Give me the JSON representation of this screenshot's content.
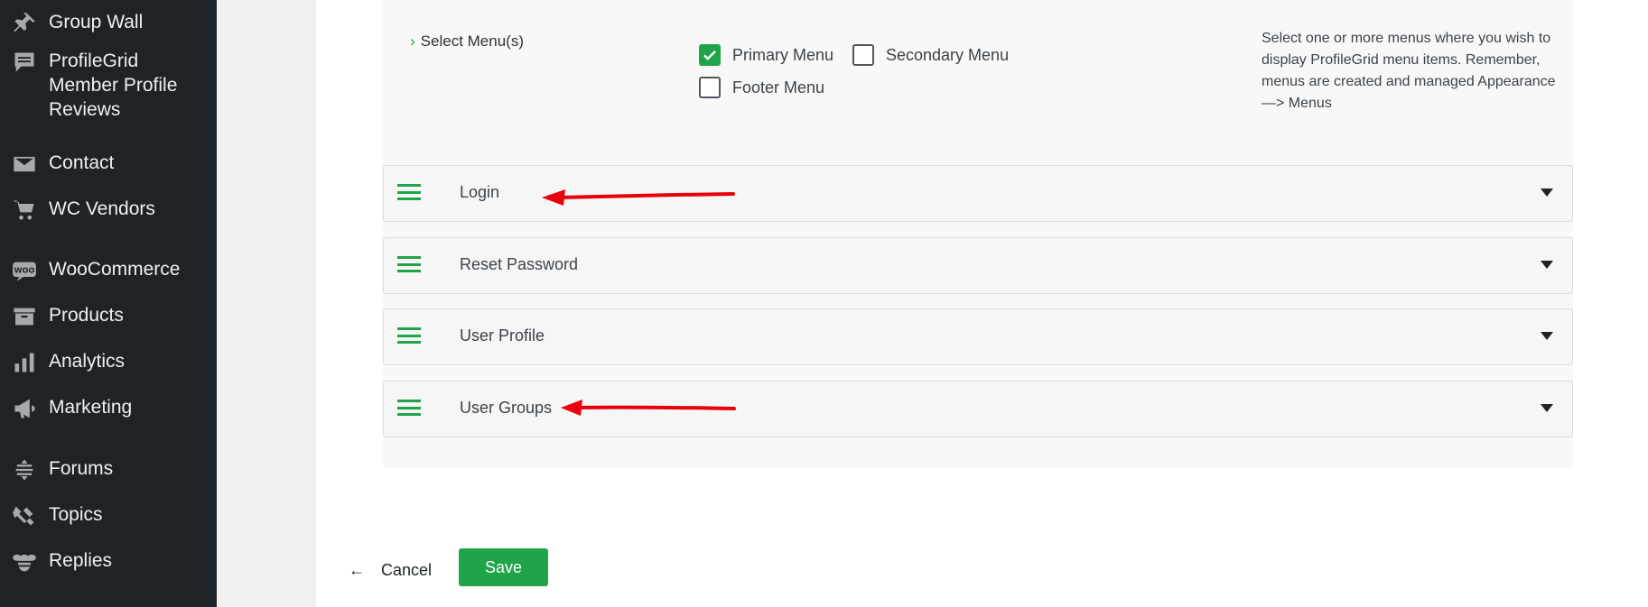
{
  "sidebar": {
    "items": [
      {
        "label": "Group Wall",
        "icon": "pin-icon"
      },
      {
        "label": "ProfileGrid Member Profile Reviews",
        "icon": "comment-icon"
      },
      {
        "label": "Contact",
        "icon": "mail-icon"
      },
      {
        "label": "WC Vendors",
        "icon": "cart-icon"
      },
      {
        "label": "WooCommerce",
        "icon": "woo-icon"
      },
      {
        "label": "Products",
        "icon": "archive-icon"
      },
      {
        "label": "Analytics",
        "icon": "bar-chart-icon"
      },
      {
        "label": "Marketing",
        "icon": "megaphone-icon"
      },
      {
        "label": "Forums",
        "icon": "forums-icon"
      },
      {
        "label": "Topics",
        "icon": "topics-icon"
      },
      {
        "label": "Replies",
        "icon": "bee-icon"
      }
    ]
  },
  "menu_settings": {
    "label": "Select Menu(s)",
    "options": [
      {
        "label": "Primary Menu",
        "checked": true
      },
      {
        "label": "Secondary Menu",
        "checked": false
      },
      {
        "label": "Footer Menu",
        "checked": false
      }
    ],
    "help_text": "Select one or more menus where you wish to display ProfileGrid menu items. Remember, menus are created and managed Appearance —> Menus"
  },
  "sections": [
    {
      "title": "Login",
      "annotated": true
    },
    {
      "title": "Reset Password",
      "annotated": false
    },
    {
      "title": "User Profile",
      "annotated": false
    },
    {
      "title": "User Groups",
      "annotated": true
    }
  ],
  "footer": {
    "cancel_label": "Cancel",
    "save_label": "Save"
  },
  "colors": {
    "accent": "#1fa44a",
    "sidebar_bg": "#1d2327",
    "annotation": "#e8000c"
  }
}
